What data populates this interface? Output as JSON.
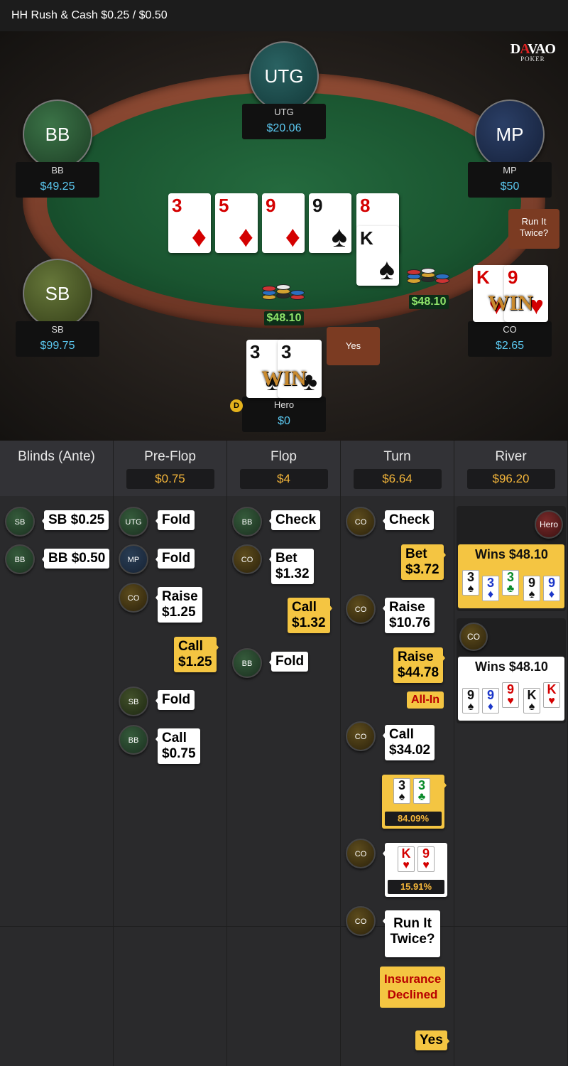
{
  "title": "HH  Rush & Cash $0.25 / $0.50",
  "logo": {
    "main": "DAVAO",
    "sub": "POKER"
  },
  "seats": [
    {
      "pos": "UTG",
      "name": "UTG",
      "stack": "$20.06",
      "color": "#1c4d4d"
    },
    {
      "pos": "BB",
      "name": "BB",
      "stack": "$49.25",
      "color": "#2b5633"
    },
    {
      "pos": "MP",
      "name": "MP",
      "stack": "$50",
      "color": "#1c2c4a"
    },
    {
      "pos": "SB",
      "name": "SB",
      "stack": "$99.75",
      "color": "#4b5a25"
    },
    {
      "pos": "CO",
      "name": "CO",
      "stack": "$2.65"
    },
    {
      "pos": "Hero",
      "name": "Hero",
      "stack": "$0"
    }
  ],
  "board": [
    {
      "rank": "3",
      "suit": "♦",
      "color": "red"
    },
    {
      "rank": "5",
      "suit": "♦",
      "color": "red"
    },
    {
      "rank": "9",
      "suit": "♦",
      "color": "red"
    },
    {
      "rank": "9",
      "suit": "♠",
      "color": "blk"
    },
    {
      "rank": "8",
      "suit": "♦",
      "color": "red"
    },
    {
      "rank": "K",
      "suit": "♠",
      "color": "blk"
    }
  ],
  "co_cards": [
    {
      "rank": "K",
      "suit": "♥"
    },
    {
      "rank": "9",
      "suit": "♥"
    }
  ],
  "hero_cards": [
    {
      "rank": "3",
      "suit": "♠"
    },
    {
      "rank": "3",
      "suit": "♣"
    }
  ],
  "win_text": "WIN",
  "pots": [
    "$48.10",
    "$48.10"
  ],
  "run_it_twice": "Run It Twice?",
  "yes_button": "Yes",
  "dealer_button": "D",
  "streets": [
    {
      "name": "Blinds (Ante)",
      "pot": ""
    },
    {
      "name": "Pre-Flop",
      "pot": "$0.75"
    },
    {
      "name": "Flop",
      "pot": "$4"
    },
    {
      "name": "Turn",
      "pot": "$6.64"
    },
    {
      "name": "River",
      "pot": "$96.20"
    }
  ],
  "actions": {
    "blinds": [
      {
        "who": "SB",
        "text": "SB $0.25"
      },
      {
        "who": "BB",
        "text": "BB $0.50"
      }
    ],
    "preflop": [
      {
        "who": "UTG",
        "text": "Fold"
      },
      {
        "who": "MP",
        "text": "Fold"
      },
      {
        "who": "CO",
        "l1": "Raise",
        "l2": "$1.25"
      },
      {
        "who": "Hero",
        "l1": "Call",
        "l2": "$1.25"
      },
      {
        "who": "SB",
        "text": "Fold"
      },
      {
        "who": "BB",
        "l1": "Call",
        "l2": "$0.75"
      }
    ],
    "flop": [
      {
        "who": "BB",
        "text": "Check"
      },
      {
        "who": "CO",
        "l1": "Bet",
        "l2": "$1.32"
      },
      {
        "who": "Hero",
        "l1": "Call",
        "l2": "$1.32"
      },
      {
        "who": "BB",
        "text": "Fold"
      }
    ],
    "turn": [
      {
        "who": "CO",
        "text": "Check"
      },
      {
        "who": "Hero",
        "l1": "Bet",
        "l2": "$3.72"
      },
      {
        "who": "CO",
        "l1": "Raise",
        "l2": "$10.76"
      },
      {
        "who": "Hero",
        "l1": "Raise",
        "l2": "$44.78"
      },
      {
        "who": "Hero",
        "text": "All-In"
      },
      {
        "who": "CO",
        "l1": "Call",
        "l2": "$34.02"
      },
      {
        "who": "Hero",
        "equity": "84.09%"
      },
      {
        "who": "CO",
        "equity": "15.91%"
      },
      {
        "who": "CO",
        "l1": "Run It",
        "l2": "Twice?"
      },
      {
        "who": "Hero",
        "l1": "Insurance",
        "l2": "Declined"
      },
      {
        "who": "Hero",
        "text": "Yes"
      }
    ],
    "river": [
      {
        "who": "Hero",
        "text": "Wins $48.10",
        "cards": [
          [
            "3",
            "♠"
          ],
          [
            "3",
            "♦"
          ],
          [
            "3",
            "♣"
          ],
          [
            "9",
            "♠"
          ],
          [
            "9",
            "♦"
          ]
        ]
      },
      {
        "who": "CO",
        "text": "Wins $48.10",
        "cards": [
          [
            "9",
            "♠"
          ],
          [
            "9",
            "♦"
          ],
          [
            "9",
            "♥"
          ],
          [
            "K",
            "♠"
          ],
          [
            "K",
            "♥"
          ]
        ]
      }
    ]
  }
}
